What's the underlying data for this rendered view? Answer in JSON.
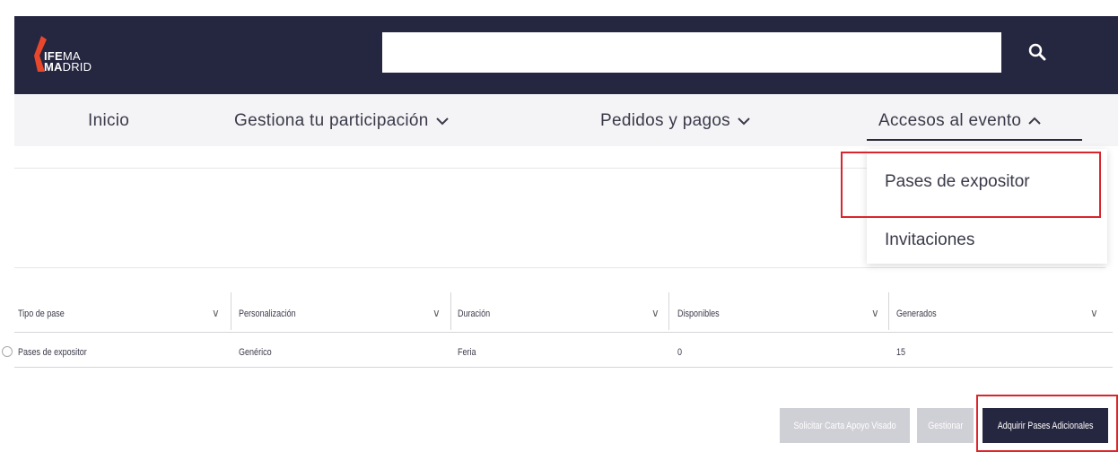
{
  "header": {
    "logo_line1_bold": "IFE",
    "logo_line1_thin": "MA",
    "logo_line2_bold": "MA",
    "logo_line2_thin": "DRID",
    "search_placeholder": ""
  },
  "nav": {
    "items": [
      {
        "label": "Inicio"
      },
      {
        "label": "Gestiona tu participación"
      },
      {
        "label": "Pedidos y pagos"
      },
      {
        "label": "Accesos al evento"
      }
    ]
  },
  "dropdown": {
    "items": [
      {
        "label": "Pases de expositor"
      },
      {
        "label": "Invitaciones"
      }
    ]
  },
  "table": {
    "columns": [
      "Tipo de pase",
      "Personalización",
      "Duración",
      "Disponibles",
      "Generados"
    ],
    "rows": [
      [
        "Pases de expositor",
        "Genérico",
        "Feria",
        "0",
        "15"
      ]
    ]
  },
  "actions": {
    "solicitar": "Solicitar Carta Apoyo Visado",
    "gestionar": "Gestionar",
    "adquirir": "Adquirir Pases Adicionales"
  },
  "colors": {
    "header_bg": "#25263f",
    "accent": "#e8472b",
    "highlight": "#d9262c"
  }
}
